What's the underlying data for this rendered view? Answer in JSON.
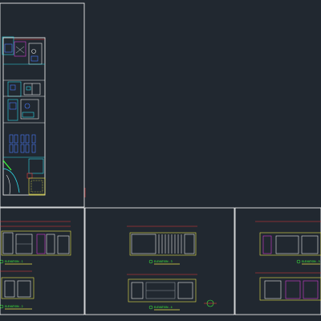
{
  "drawing": {
    "background": "#212830",
    "sheet_border_color": "#ffffff",
    "colors": {
      "wall": "#e6e6e6",
      "cyan": "#2fd8e6",
      "yellow": "#e8e24a",
      "magenta": "#d23cd2",
      "red": "#e63a3a",
      "green": "#3cff3c",
      "blue": "#4a7cff",
      "white": "#ffffff",
      "gray": "#8a8f96"
    }
  },
  "elevations": [
    {
      "label": "ELEVATION - 1"
    },
    {
      "label": "ELEVATION - 2"
    },
    {
      "label": "ELEVATION - 3"
    },
    {
      "label": "ELEVATION - 4"
    },
    {
      "label": "ELEVATION - 5"
    }
  ]
}
